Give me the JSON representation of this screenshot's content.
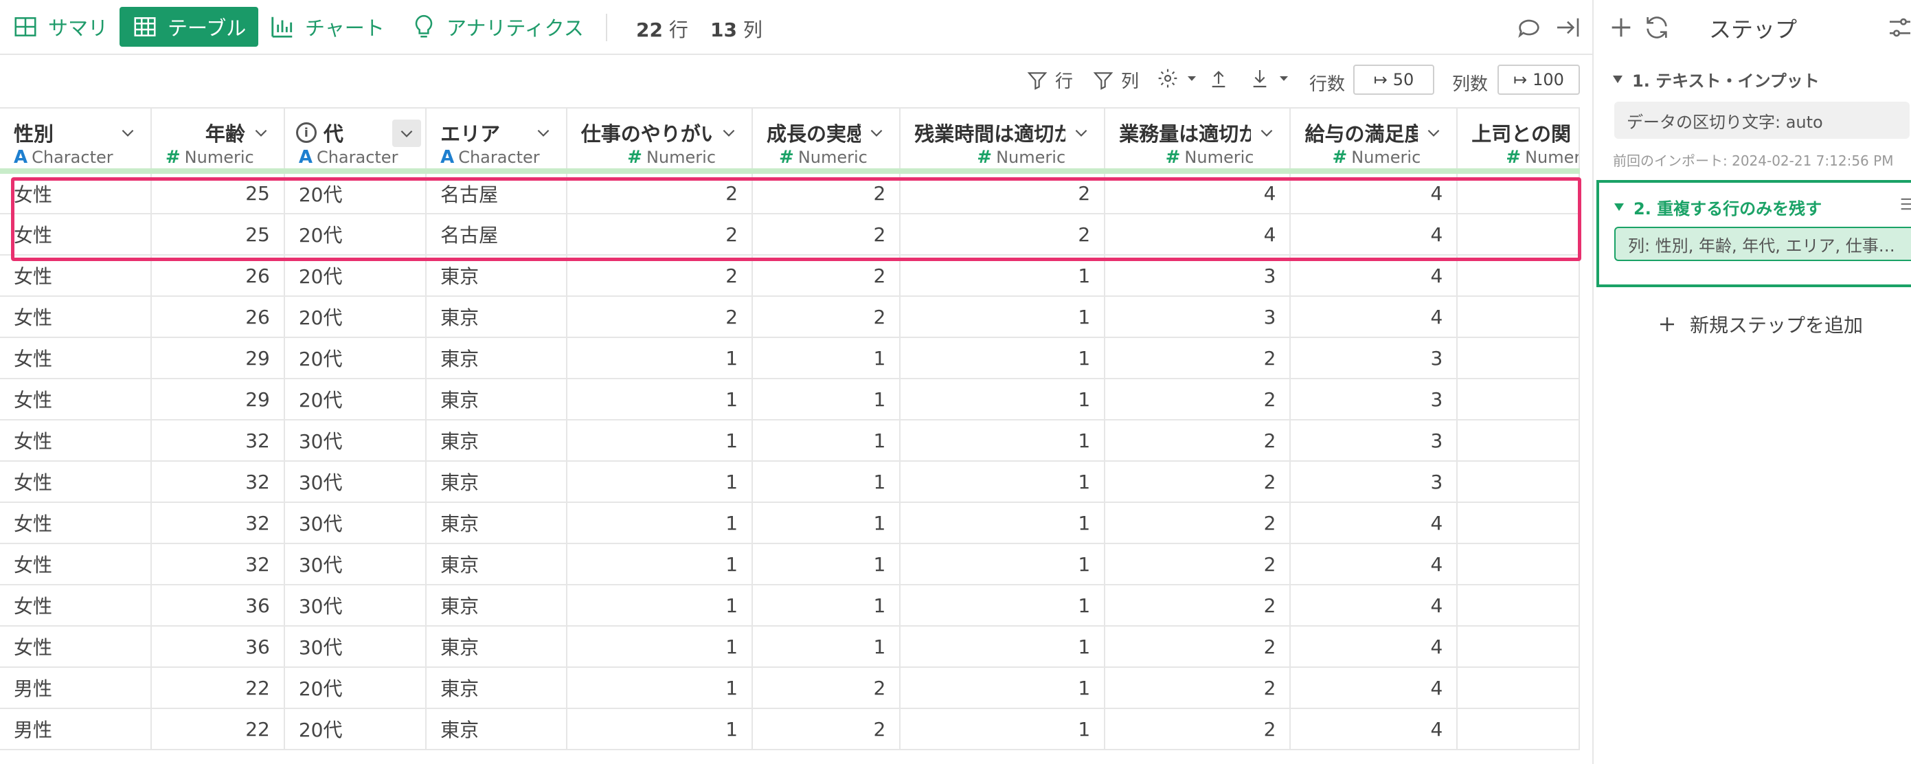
{
  "view_tabs": [
    {
      "label": "サマリ",
      "icon": "summary-grid-icon",
      "active": false
    },
    {
      "label": "テーブル",
      "icon": "table-icon",
      "active": true
    },
    {
      "label": "チャート",
      "icon": "bar-chart-icon",
      "active": false
    },
    {
      "label": "アナリティクス",
      "icon": "lightbulb-icon",
      "active": false
    }
  ],
  "row_count": {
    "number": "22",
    "unit": "行"
  },
  "col_count": {
    "number": "13",
    "unit": "列"
  },
  "toolbar": {
    "row_filter_label": "行",
    "col_filter_label": "列",
    "rows_label": "行数",
    "rows_value": "50",
    "cols_label": "列数",
    "cols_value": "100"
  },
  "columns": [
    {
      "name": "性別",
      "type": "Character",
      "align": "left"
    },
    {
      "name": "年齢",
      "type": "Numeric",
      "align": "right"
    },
    {
      "name": "代",
      "type": "Character",
      "align": "left",
      "info": true
    },
    {
      "name": "エリア",
      "type": "Character",
      "align": "left"
    },
    {
      "name": "仕事のやりがい",
      "type": "Numeric",
      "align": "right"
    },
    {
      "name": "成長の実感",
      "type": "Numeric",
      "align": "right"
    },
    {
      "name": "残業時間は適切か",
      "type": "Numeric",
      "align": "right"
    },
    {
      "name": "業務量は適切か",
      "type": "Numeric",
      "align": "right"
    },
    {
      "name": "給与の満足度",
      "type": "Numeric",
      "align": "right"
    },
    {
      "name": "上司との関",
      "type": "Numeric",
      "align": "right"
    }
  ],
  "rows": [
    [
      "女性",
      "25",
      "20代",
      "名古屋",
      "2",
      "2",
      "2",
      "4",
      "4",
      ""
    ],
    [
      "女性",
      "25",
      "20代",
      "名古屋",
      "2",
      "2",
      "2",
      "4",
      "4",
      ""
    ],
    [
      "女性",
      "26",
      "20代",
      "東京",
      "2",
      "2",
      "1",
      "3",
      "4",
      ""
    ],
    [
      "女性",
      "26",
      "20代",
      "東京",
      "2",
      "2",
      "1",
      "3",
      "4",
      ""
    ],
    [
      "女性",
      "29",
      "20代",
      "東京",
      "1",
      "1",
      "1",
      "2",
      "3",
      ""
    ],
    [
      "女性",
      "29",
      "20代",
      "東京",
      "1",
      "1",
      "1",
      "2",
      "3",
      ""
    ],
    [
      "女性",
      "32",
      "30代",
      "東京",
      "1",
      "1",
      "1",
      "2",
      "3",
      ""
    ],
    [
      "女性",
      "32",
      "30代",
      "東京",
      "1",
      "1",
      "1",
      "2",
      "3",
      ""
    ],
    [
      "女性",
      "32",
      "30代",
      "東京",
      "1",
      "1",
      "1",
      "2",
      "4",
      ""
    ],
    [
      "女性",
      "32",
      "30代",
      "東京",
      "1",
      "1",
      "1",
      "2",
      "4",
      ""
    ],
    [
      "女性",
      "36",
      "30代",
      "東京",
      "1",
      "1",
      "1",
      "2",
      "4",
      ""
    ],
    [
      "女性",
      "36",
      "30代",
      "東京",
      "1",
      "1",
      "1",
      "2",
      "4",
      ""
    ],
    [
      "男性",
      "22",
      "20代",
      "東京",
      "1",
      "2",
      "1",
      "2",
      "4",
      ""
    ],
    [
      "男性",
      "22",
      "20代",
      "東京",
      "1",
      "2",
      "1",
      "2",
      "4",
      ""
    ]
  ],
  "side_panel": {
    "title": "ステップ",
    "step1": {
      "title": "1. テキスト・インプット",
      "chip": "データの区切り文字: auto",
      "timestamp": "前回のインポート: 2024-02-21 7:12:56 PM"
    },
    "step2": {
      "title": "2. 重複する行のみを残す",
      "chip": "列: 性別, 年齢, 年代, エリア, 仕事の..."
    },
    "add_step_label": "新規ステップを追加"
  },
  "colors": {
    "accent": "#1a9a68",
    "highlight": "#e8306e",
    "type_character": "#1e7fcf",
    "type_numeric": "#1aa266"
  }
}
